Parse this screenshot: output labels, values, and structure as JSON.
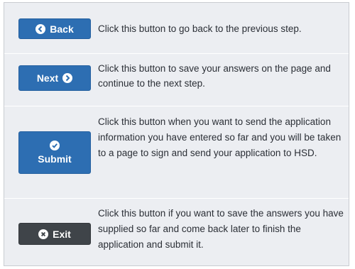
{
  "buttons": {
    "back": {
      "label": "Back",
      "description": "Click this button to go back to the previous step."
    },
    "next": {
      "label": "Next",
      "description": "Click this button to save your answers on the page and continue to the next step."
    },
    "submit": {
      "label": "Submit",
      "description": "Click this button when you want to send the application information you have entered so far and you will be taken to a page to sign and send your application to HSD."
    },
    "exit": {
      "label": "Exit",
      "description": "Click this button if you want to save the answers you have supplied so far and come back later to finish the application and submit it."
    }
  },
  "icons": {
    "back": "arrow-left-circle-icon",
    "next": "arrow-right-circle-icon",
    "submit": "check-circle-icon",
    "exit": "x-circle-icon"
  },
  "colors": {
    "primary_button": "#2d6eb2",
    "exit_button": "#3f4449",
    "panel_background": "#eceef2",
    "text": "#2b2f36"
  }
}
